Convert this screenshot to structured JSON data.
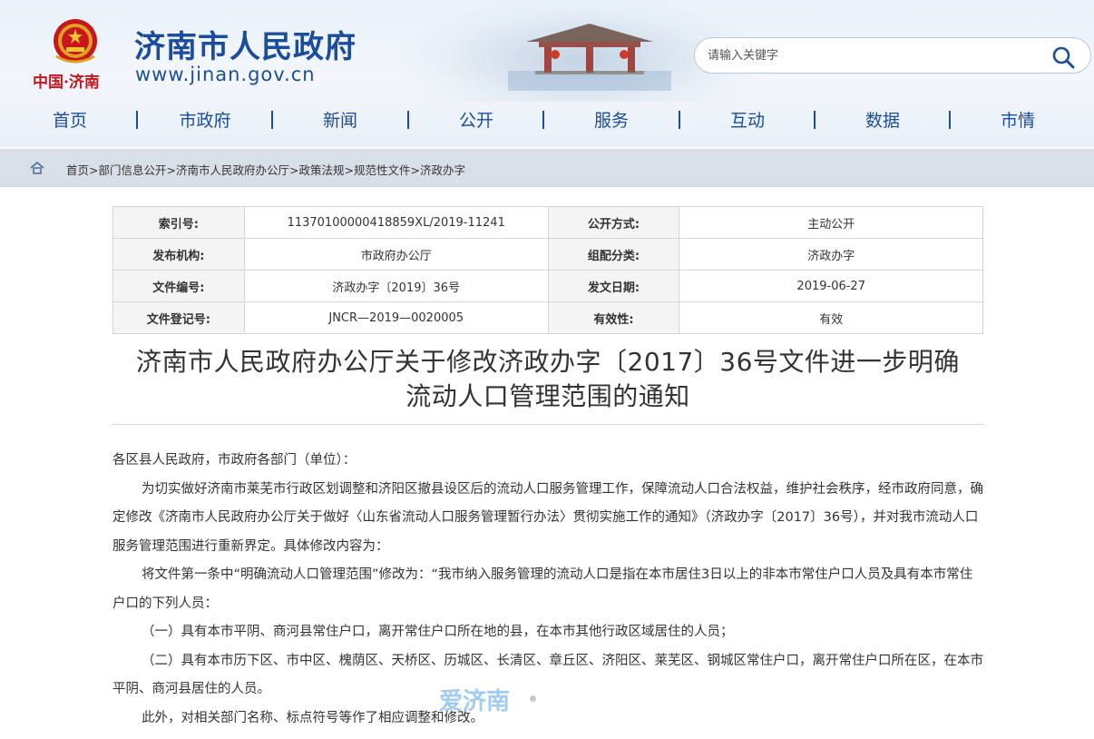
{
  "header": {
    "brand_text": "中国·济南",
    "site_title": "济南市人民政府",
    "site_url": "www.jinan.gov.cn",
    "search_placeholder": "请输入关键字"
  },
  "nav": {
    "items": [
      "首页",
      "市政府",
      "新闻",
      "公开",
      "服务",
      "互动",
      "数据",
      "市情"
    ],
    "color": "#1c4d9c"
  },
  "breadcrumb": {
    "items": [
      "首页",
      "部门信息公开",
      "济南市人民政府办公厅",
      "政策法规",
      "规范性文件",
      "济政办字"
    ],
    "separator": ">"
  },
  "meta": {
    "rows": [
      {
        "k1": "索引号:",
        "v1": "11370100000418859XL/2019-11241",
        "k2": "公开方式:",
        "v2": "主动公开"
      },
      {
        "k1": "发布机构:",
        "v1": "市政府办公厅",
        "k2": "组配分类:",
        "v2": "济政办字"
      },
      {
        "k1": "文件编号:",
        "v1": "济政办字〔2019〕36号",
        "k2": "发文日期:",
        "v2": "2019-06-27"
      },
      {
        "k1": "文件登记号:",
        "v1": "JNCR—2019—0020005",
        "k2": "有效性:",
        "v2": "有效"
      }
    ]
  },
  "document": {
    "title_line1": "济南市人民政府办公厅关于修改济政办字〔2017〕36号文件进一步明确",
    "title_line2": "流动人口管理范围的通知",
    "paragraphs": [
      "各区县人民政府，市政府各部门（单位）：",
      "为切实做好济南市莱芜市行政区划调整和济阳区撤县设区后的流动人口服务管理工作，保障流动人口合法权益，维护社会秩序，经市政府同意，确定修改《济南市人民政府办公厅关于做好〈山东省流动人口服务管理暂行办法〉贯彻实施工作的通知》（济政办字〔2017〕36号），并对我市流动人口服务管理范围进行重新界定。具体修改内容为：",
      "将文件第一条中“明确流动人口管理范围”修改为：“我市纳入服务管理的流动人口是指在本市居住3日以上的非本市常住户口人员及具有本市常住户口的下列人员：",
      "（一）具有本市平阴、商河县常住户口，离开常住户口所在地的县，在本市其他行政区域居住的人员；",
      "（二）具有本市历下区、市中区、槐荫区、天桥区、历城区、长清区、章丘区、济阳区、莱芜区、钢城区常住户口，离开常住户口所在区，在本市平阴、商河县居住的人员。",
      "此外，对相关部门名称、标点符号等作了相应调整和修改。"
    ]
  },
  "watermark": "爱济南"
}
